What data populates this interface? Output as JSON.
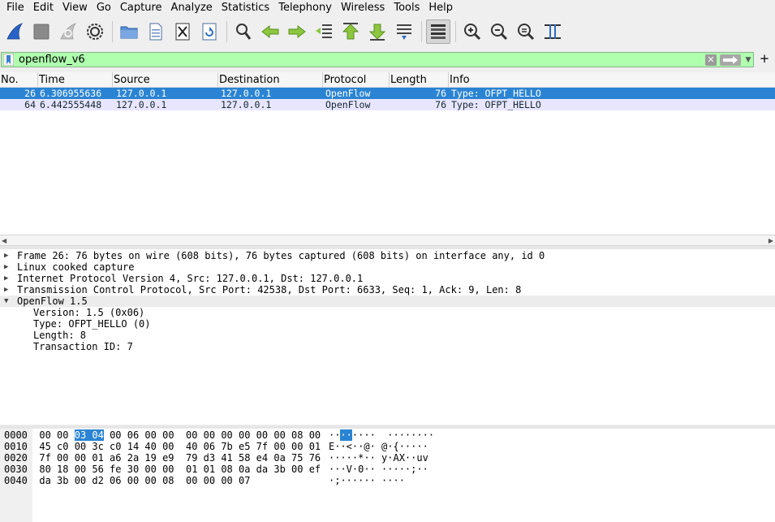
{
  "menu": [
    "File",
    "Edit",
    "View",
    "Go",
    "Capture",
    "Analyze",
    "Statistics",
    "Telephony",
    "Wireless",
    "Tools",
    "Help"
  ],
  "filter": {
    "value": "openflow_v6"
  },
  "columns": [
    "No.",
    "Time",
    "Source",
    "Destination",
    "Protocol",
    "Length",
    "Info"
  ],
  "packets": [
    {
      "no": "26",
      "time": "6.306955636",
      "source": "127.0.0.1",
      "destination": "127.0.0.1",
      "protocol": "OpenFlow",
      "length": "76",
      "info": "Type: OFPT_HELLO"
    },
    {
      "no": "64",
      "time": "6.442555448",
      "source": "127.0.0.1",
      "destination": "127.0.0.1",
      "protocol": "OpenFlow",
      "length": "76",
      "info": "Type: OFPT_HELLO"
    }
  ],
  "details": [
    "Frame 26: 76 bytes on wire (608 bits), 76 bytes captured (608 bits) on interface any, id 0",
    "Linux cooked capture",
    "Internet Protocol Version 4, Src: 127.0.0.1, Dst: 127.0.0.1",
    "Transmission Control Protocol, Src Port: 42538, Dst Port: 6633, Seq: 1, Ack: 9, Len: 8",
    "OpenFlow 1.5",
    "Version: 1.5 (0x06)",
    "Type: OFPT_HELLO (0)",
    "Length: 8",
    "Transaction ID: 7"
  ],
  "bytes": [
    {
      "offset": "0000",
      "pre": "00 00 ",
      "sel": "03 04",
      "post": " 00 06 00 00  00 00 00 00 00 00 08 00",
      "ascii_pre": "··",
      "ascii_sel": "··",
      "ascii_post": "····  ········"
    },
    {
      "offset": "0010",
      "pre": "45 c0 00 3c c0 14 40 00  40 06 7b e5 7f 00 00 01",
      "sel": "",
      "post": "",
      "ascii_pre": "E··<··@· @·{·····",
      "ascii_sel": "",
      "ascii_post": ""
    },
    {
      "offset": "0020",
      "pre": "7f 00 00 01 a6 2a 19 e9  79 d3 41 58 e4 0a 75 76",
      "sel": "",
      "post": "",
      "ascii_pre": "·····*·· y·AX··uv",
      "ascii_sel": "",
      "ascii_post": ""
    },
    {
      "offset": "0030",
      "pre": "80 18 00 56 fe 30 00 00  01 01 08 0a da 3b 00 ef",
      "sel": "",
      "post": "",
      "ascii_pre": "···V·0·· ·····;··",
      "ascii_sel": "",
      "ascii_post": ""
    },
    {
      "offset": "0040",
      "pre": "da 3b 00 d2 06 00 00 08  00 00 00 07",
      "sel": "",
      "post": "",
      "ascii_pre": "·;······ ····",
      "ascii_sel": "",
      "ascii_post": ""
    }
  ]
}
